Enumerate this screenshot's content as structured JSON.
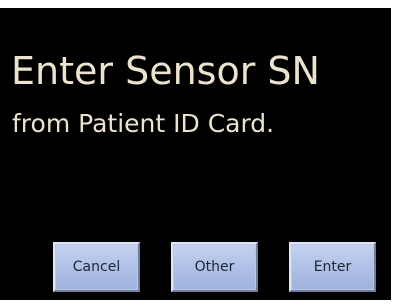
{
  "screen": {
    "title": "Enter Sensor SN",
    "subtitle": "from Patient ID Card."
  },
  "buttons": {
    "cancel_label": "Cancel",
    "other_label": "Other",
    "enter_label": "Enter"
  },
  "colors": {
    "screen_background": "#000000",
    "text": "#ece3cf",
    "button_face": "#aebfe6"
  }
}
